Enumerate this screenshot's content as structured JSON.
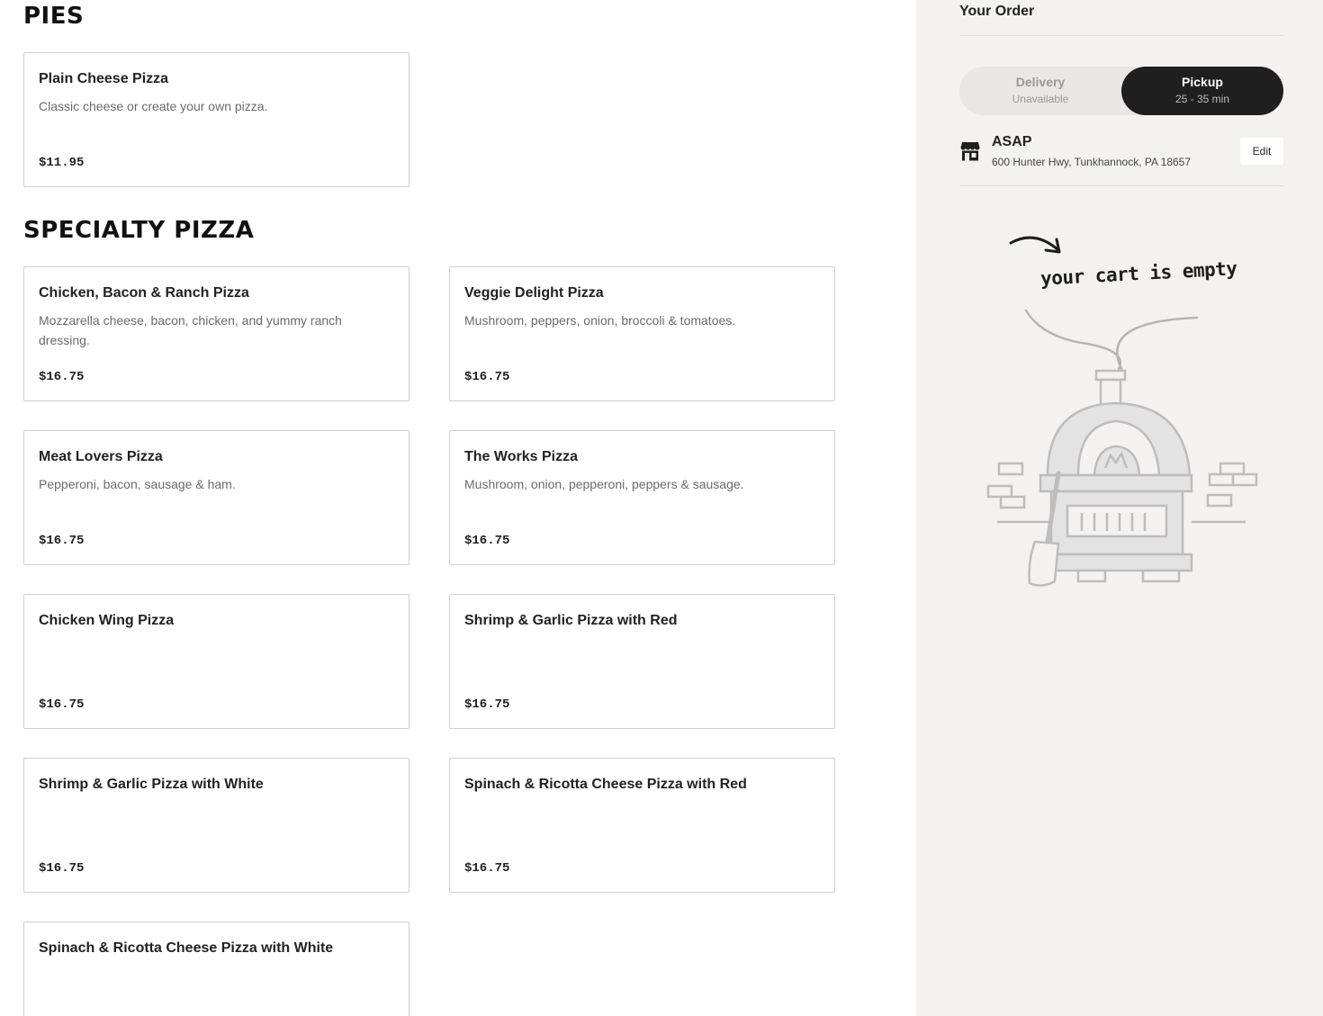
{
  "menu": {
    "sections": [
      {
        "title": "PIES",
        "items": [
          {
            "name": "Plain Cheese Pizza",
            "description": "Classic cheese or create your own pizza.",
            "price": "$11.95"
          }
        ]
      },
      {
        "title": "SPECIALTY PIZZA",
        "items": [
          {
            "name": "Chicken, Bacon & Ranch Pizza",
            "description": "Mozzarella cheese, bacon, chicken, and yummy ranch dressing.",
            "price": "$16.75"
          },
          {
            "name": "Veggie Delight Pizza",
            "description": "Mushroom, peppers, onion, broccoli & tomatoes.",
            "price": "$16.75"
          },
          {
            "name": "Meat Lovers Pizza",
            "description": "Pepperoni, bacon, sausage & ham.",
            "price": "$16.75"
          },
          {
            "name": "The Works Pizza",
            "description": "Mushroom, onion, pepperoni, peppers & sausage.",
            "price": "$16.75"
          },
          {
            "name": "Chicken Wing Pizza",
            "description": "",
            "price": "$16.75"
          },
          {
            "name": "Shrimp & Garlic Pizza with Red",
            "description": "",
            "price": "$16.75"
          },
          {
            "name": "Shrimp & Garlic Pizza with White",
            "description": "",
            "price": "$16.75"
          },
          {
            "name": "Spinach & Ricotta Cheese Pizza with Red",
            "description": "",
            "price": "$16.75"
          },
          {
            "name": "Spinach & Ricotta Cheese Pizza with White",
            "description": "",
            "price": ""
          }
        ]
      }
    ]
  },
  "order": {
    "title": "Your Order",
    "delivery": {
      "label": "Delivery",
      "sub": "Unavailable"
    },
    "pickup": {
      "label": "Pickup",
      "sub": "25 - 35 min",
      "selected": true
    },
    "time": "ASAP",
    "address": "600 Hunter Hwy, Tunkhannock, PA 18657",
    "edit_label": "Edit",
    "empty_text": "your cart is empty",
    "icons": {
      "store": "store-icon",
      "arrow": "arrow-icon",
      "oven": "pizza-oven-illustration"
    }
  },
  "colors": {
    "sidebar_bg": "#f3f2ef",
    "selected_toggle": "#1f1f1f",
    "card_border": "#cfcfcf"
  }
}
